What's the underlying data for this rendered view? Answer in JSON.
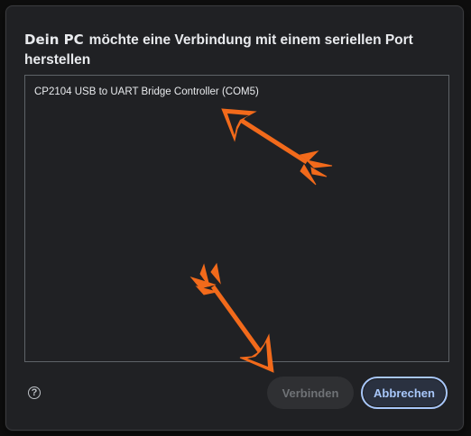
{
  "dialog": {
    "origin": "Dein PC",
    "title": "möchte eine Verbindung mit einem seriellen Port herstellen"
  },
  "ports": [
    {
      "label": "CP2104 USB to UART Bridge Controller (COM5)"
    }
  ],
  "footer": {
    "help_icon": "help-circle-icon",
    "help_glyph": "?",
    "connect_label": "Verbinden",
    "cancel_label": "Abbrechen"
  },
  "colors": {
    "annotation_arrow": "#f26a1b",
    "accent": "#a8c7fa"
  }
}
